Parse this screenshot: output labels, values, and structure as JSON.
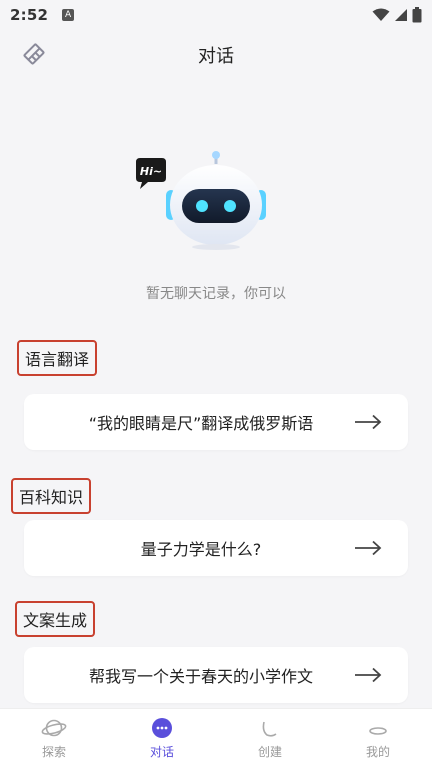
{
  "status_bar": {
    "time": "2:52",
    "notif_letter": "A"
  },
  "header": {
    "title": "对话",
    "left_icon": "eraser-icon"
  },
  "hero": {
    "bubble_text": "Hi~",
    "empty_text": "暂无聊天记录，你可以"
  },
  "sections": [
    {
      "label": "语言翻译",
      "prompt": "“我的眼睛是尺”翻译成俄罗斯语"
    },
    {
      "label": "百科知识",
      "prompt": "量子力学是什么?"
    },
    {
      "label": "文案生成",
      "prompt": "帮我写一个关于春天的小学作文"
    }
  ],
  "bottom_nav": {
    "items": [
      {
        "label": "探索",
        "icon": "planet-icon",
        "active": false
      },
      {
        "label": "对话",
        "icon": "chat-bubble-icon",
        "active": true
      },
      {
        "label": "创建",
        "icon": "create-icon",
        "active": false
      },
      {
        "label": "我的",
        "icon": "profile-icon",
        "active": false
      }
    ]
  },
  "colors": {
    "accent": "#5a4fdb",
    "highlight_border": "#c8412f",
    "background": "#f5f5f7"
  }
}
